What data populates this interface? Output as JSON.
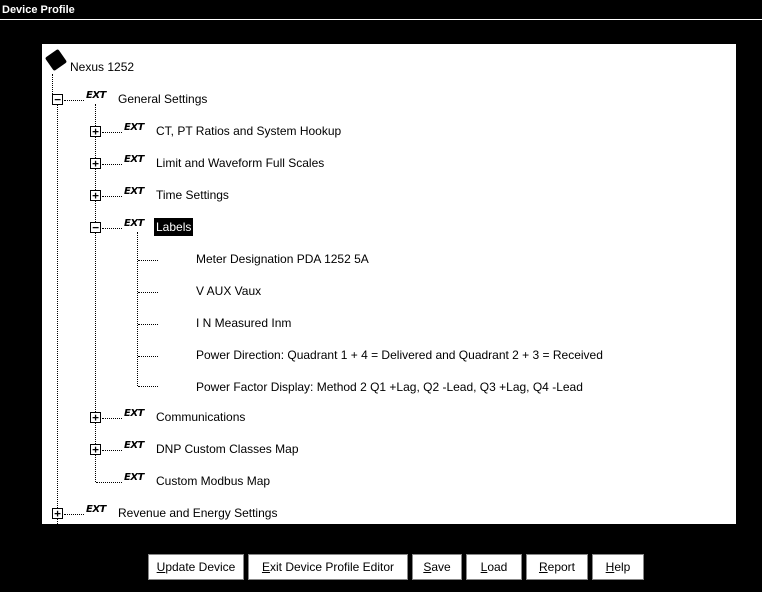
{
  "window": {
    "title": "Device Profile"
  },
  "tree": {
    "root": "Nexus 1252",
    "ext_badge": "EXT",
    "general": "General Settings",
    "children": [
      "CT, PT Ratios and System Hookup",
      "Limit and Waveform Full Scales",
      "Time Settings",
      "Labels",
      "Communications",
      "DNP Custom Classes Map",
      "Custom Modbus Map"
    ],
    "labels_items": [
      "Meter Designation    PDA 1252 5A",
      "V AUX    Vaux",
      "I N Measured    Inm",
      "Power Direction:  Quadrant 1 + 4 = Delivered  and  Quadrant 2 + 3 = Received",
      "Power Factor Display:  Method 2 Q1 +Lag, Q2 -Lead, Q3 +Lag, Q4 -Lead"
    ],
    "revenue": "Revenue and Energy Settings"
  },
  "buttons": [
    {
      "pre": "",
      "acc": "U",
      "post": "pdate Device"
    },
    {
      "pre": "",
      "acc": "E",
      "post": "xit Device Profile Editor"
    },
    {
      "pre": "",
      "acc": "S",
      "post": "ave"
    },
    {
      "pre": "",
      "acc": "L",
      "post": "oad"
    },
    {
      "pre": "",
      "acc": "R",
      "post": "eport"
    },
    {
      "pre": "",
      "acc": "H",
      "post": "elp"
    }
  ]
}
